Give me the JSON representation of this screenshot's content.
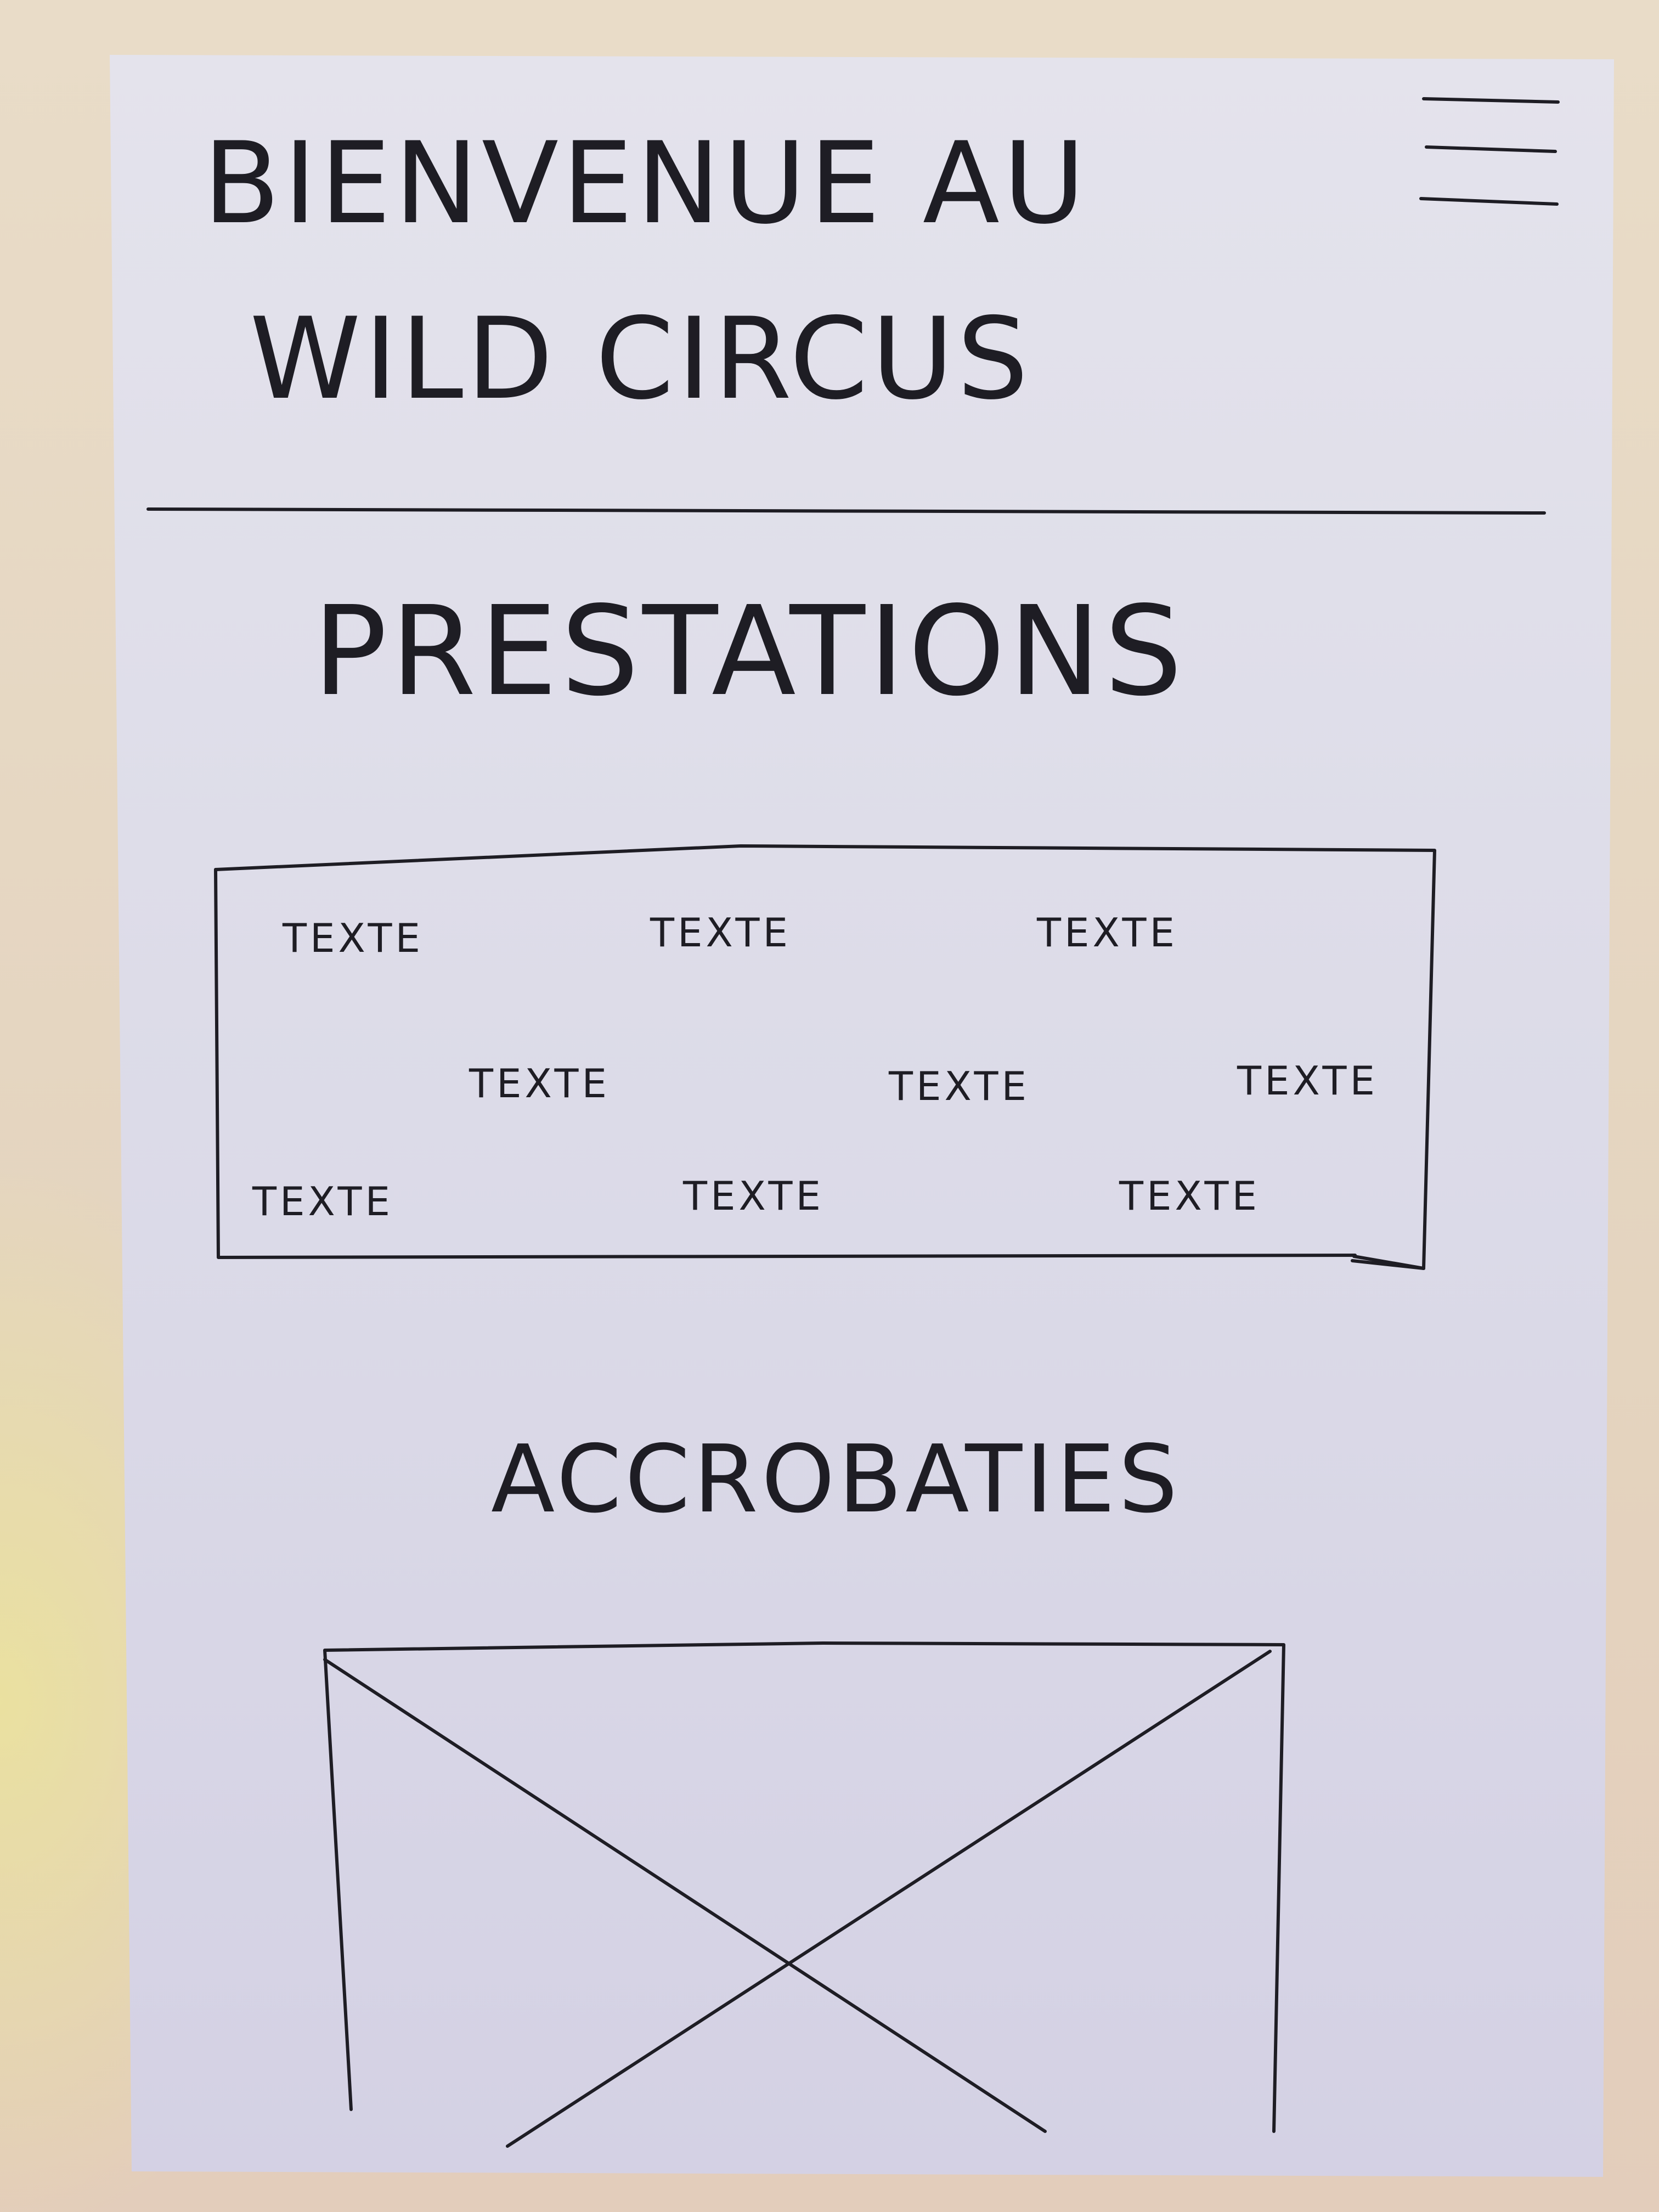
{
  "header": {
    "title_line_1": "BIENVENUE AU",
    "title_line_2": "WILD CIRCUS",
    "menu_icon": "hamburger-menu-icon"
  },
  "prestations": {
    "heading": "PRESTATIONS",
    "items": [
      "TEXTE",
      "TEXTE",
      "TEXTE",
      "TEXTE",
      "TEXTE",
      "TEXTE",
      "TEXTE",
      "TEXTE",
      "TEXTE"
    ]
  },
  "acrobaties": {
    "heading": "ACCROBATIES",
    "image_icon": "image-placeholder-icon"
  },
  "colors": {
    "ink": "#1e1d24",
    "paper": "#dedde8",
    "background": "#e6d6c2"
  }
}
